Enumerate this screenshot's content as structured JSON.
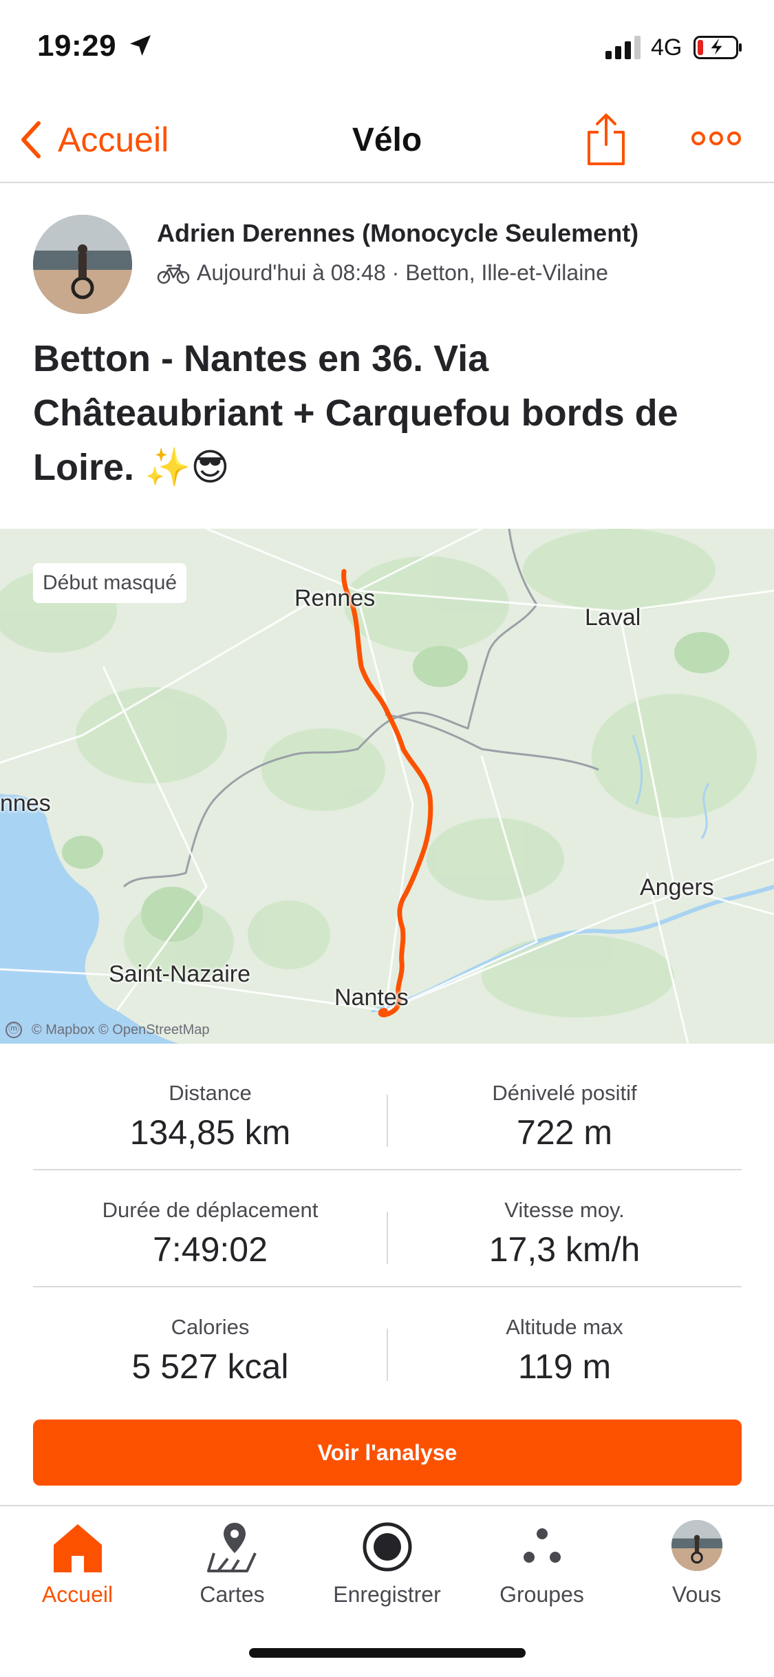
{
  "status_bar": {
    "time": "19:29",
    "network": "4G"
  },
  "nav": {
    "back_label": "Accueil",
    "title": "Vélo"
  },
  "header": {
    "athlete_name": "Adrien Derennes (Monocycle Seulement)",
    "activity_meta": "Aujourd'hui à 08:48 · Betton, Ille-et-Vilaine",
    "activity_title": "Betton - Nantes en 36. Via Châteaubriant + Carquefou bords de Loire. ✨😎"
  },
  "map": {
    "start_hidden_label": "Début masqué",
    "labels": {
      "rennes": "Rennes",
      "laval": "Laval",
      "vannes_partial": "nnes",
      "angers": "Angers",
      "saint_nazaire": "Saint-Nazaire",
      "nantes": "Nantes"
    },
    "attribution": "© Mapbox © OpenStreetMap",
    "route_color": "#fc5200"
  },
  "stats": {
    "distance": {
      "label": "Distance",
      "value": "134,85 km"
    },
    "elevation_gain": {
      "label": "Dénivelé positif",
      "value": "722 m"
    },
    "moving_time": {
      "label": "Durée de déplacement",
      "value": "7:49:02"
    },
    "avg_speed": {
      "label": "Vitesse moy.",
      "value": "17,3 km/h"
    },
    "calories": {
      "label": "Calories",
      "value": "5 527 kcal"
    },
    "max_elevation": {
      "label": "Altitude max",
      "value": "119 m"
    }
  },
  "cta": {
    "label": "Voir l'analyse"
  },
  "tab_bar": {
    "active": "home",
    "items": [
      {
        "id": "home",
        "label": "Accueil",
        "icon": "home-icon"
      },
      {
        "id": "maps",
        "label": "Cartes",
        "icon": "map-pin-icon"
      },
      {
        "id": "record",
        "label": "Enregistrer",
        "icon": "record-icon"
      },
      {
        "id": "groups",
        "label": "Groupes",
        "icon": "groups-icon"
      },
      {
        "id": "you",
        "label": "Vous",
        "icon": "avatar"
      }
    ]
  },
  "colors": {
    "accent": "#fc5200",
    "text": "#242428",
    "secondary_text": "#494950",
    "divider": "#d9d9de"
  }
}
